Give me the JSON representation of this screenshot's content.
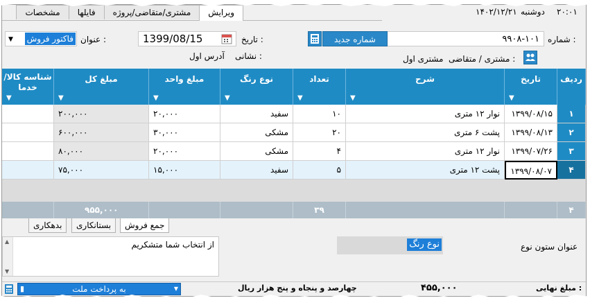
{
  "header": {
    "tabs": [
      "ویرایش",
      "مشتری/متقاضی/پروژه",
      "فایلها",
      "مشخصات"
    ],
    "active_tab": "ویرایش",
    "time": "۲۰:۰۱",
    "weekday": "دوشنبه",
    "date": "۱۴۰۲/۱۲/۲۱"
  },
  "form": {
    "number_label": "شماره :",
    "number_value": "۹۹۰۸-۱۰۱",
    "new_number_button": "شماره جدید",
    "date_label": "تاریخ :",
    "date_value": "1399/08/15",
    "title_label": "عنوان :",
    "title_value": "فاکتور فروش",
    "customer_label": "مشتری / متقاضی :",
    "customer_value": "مشتری اول",
    "address_label": "نشانی :",
    "address_value": "آدرس اول"
  },
  "table": {
    "columns": [
      "ردیف",
      "تاریخ",
      "شرح",
      "تعداد",
      "نوع رنگ",
      "مبلغ واحد",
      "مبلغ کل",
      "شناسه کالا/خدما"
    ],
    "rows": [
      {
        "no": "۱",
        "date": "۱۳۹۹/۰۸/۱۵",
        "desc": "نوار ۱۲ متری",
        "qty": "۱۰",
        "color": "سفید",
        "unit": "۲۰,۰۰۰",
        "total": "۲۰۰,۰۰۰",
        "sku": ""
      },
      {
        "no": "۲",
        "date": "۱۳۹۹/۰۸/۱۳",
        "desc": "پشت ۶ متری",
        "qty": "۲۰",
        "color": "مشکی",
        "unit": "۳۰,۰۰۰",
        "total": "۶۰۰,۰۰۰",
        "sku": ""
      },
      {
        "no": "۳",
        "date": "۱۳۹۹/۰۷/۲۶",
        "desc": "نوار ۱۲ متری",
        "qty": "۴",
        "color": "مشکی",
        "unit": "۲۰,۰۰۰",
        "total": "۸۰,۰۰۰",
        "sku": ""
      },
      {
        "no": "۴",
        "date": "۱۳۹۹/۰۸/۰۷",
        "desc": "پشت ۱۲ متری",
        "qty": "۵",
        "color": "سفید",
        "unit": "۱۵,۰۰۰",
        "total": "۷۵,۰۰۰",
        "sku": ""
      }
    ],
    "footer": {
      "count": "۴",
      "qty_sum": "۳۹",
      "total_sum": "۹۵۵,۰۰۰"
    }
  },
  "bottom_tabs": [
    "جمع فروش",
    "بستانکاری",
    "بدهکاری"
  ],
  "notes": {
    "text": "از انتخاب شما متشکریم",
    "column_title_label": "عنوان ستون نوع",
    "column_title_value": "نوع رنگ"
  },
  "status": {
    "payment_method": "به پرداخت ملت",
    "amount_words": "چهارصد و پنجاه و پنج هزار  ریال",
    "final_amount": "۴۵۵,۰۰۰",
    "final_label": "مبلغ نهایی :"
  },
  "colors": {
    "accent": "#1f8bc4",
    "selected": "#1e7fd8",
    "total_row": "#aebdc8"
  }
}
